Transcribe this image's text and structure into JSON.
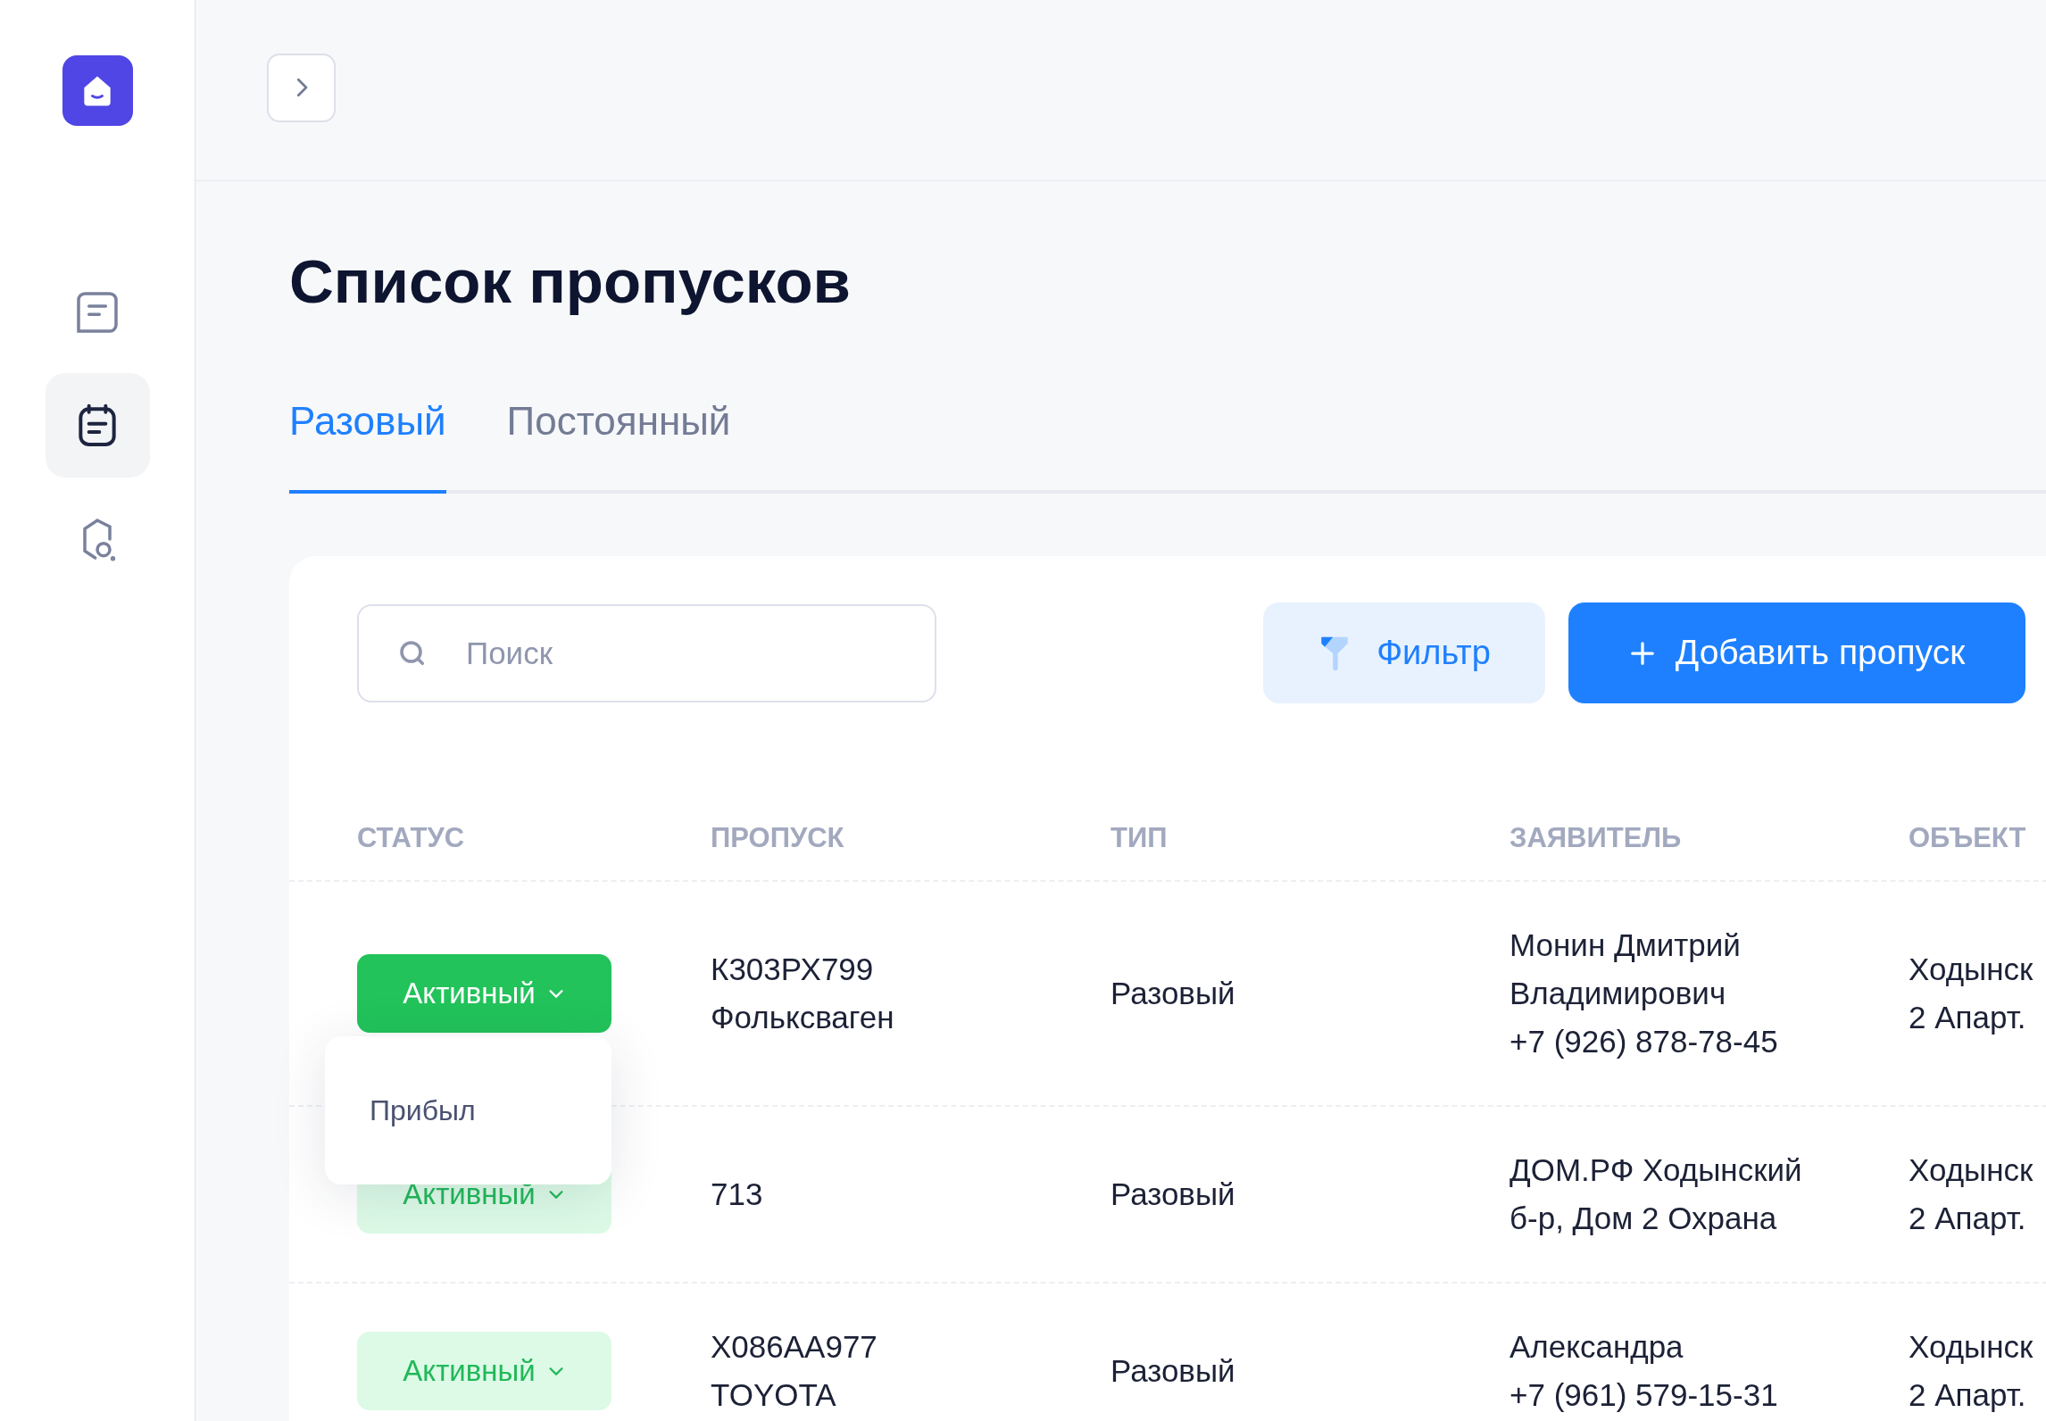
{
  "sidebar": {
    "items": [
      {
        "kind": "note",
        "selected": false
      },
      {
        "kind": "calendar",
        "selected": true
      },
      {
        "kind": "shield-search",
        "selected": false
      }
    ]
  },
  "title": "Список пропусков",
  "tabs": [
    {
      "label": "Разовый",
      "selected": true
    },
    {
      "label": "Постоянный",
      "selected": false
    }
  ],
  "search": {
    "placeholder": "Поиск"
  },
  "buttons": {
    "filter": "Фильтр",
    "add": "Добавить пропуск"
  },
  "table": {
    "columns": [
      "СТАТУС",
      "ПРОПУСК",
      "ТИП",
      "ЗАЯВИТЕЛЬ",
      "ОБЪЕКТ"
    ],
    "rows": [
      {
        "status": {
          "label": "Активный",
          "expanded": true,
          "options": [
            "Прибыл"
          ]
        },
        "pass": [
          "К303РХ799",
          "Фольксваген"
        ],
        "type": "Разовый",
        "applicant": [
          "Монин Дмитрий",
          "Владимирович",
          "+7 (926) 878-78-45"
        ],
        "object": [
          "Ходынск",
          "2 Апарт."
        ]
      },
      {
        "status": {
          "label": "Активный",
          "expanded": false
        },
        "pass": [
          "713"
        ],
        "type": "Разовый",
        "applicant": [
          "ДОМ.РФ Ходынский",
          "б-р, Дом 2 Охрана"
        ],
        "object": [
          "Ходынск",
          "2 Апарт."
        ]
      },
      {
        "status": {
          "label": "Активный",
          "expanded": false
        },
        "pass": [
          "Х086АА977",
          "TOYOTA"
        ],
        "type": "Разовый",
        "applicant": [
          "Александра",
          "+7 (961) 579-15-31"
        ],
        "object": [
          "Ходынск",
          "2 Апарт."
        ]
      }
    ]
  }
}
